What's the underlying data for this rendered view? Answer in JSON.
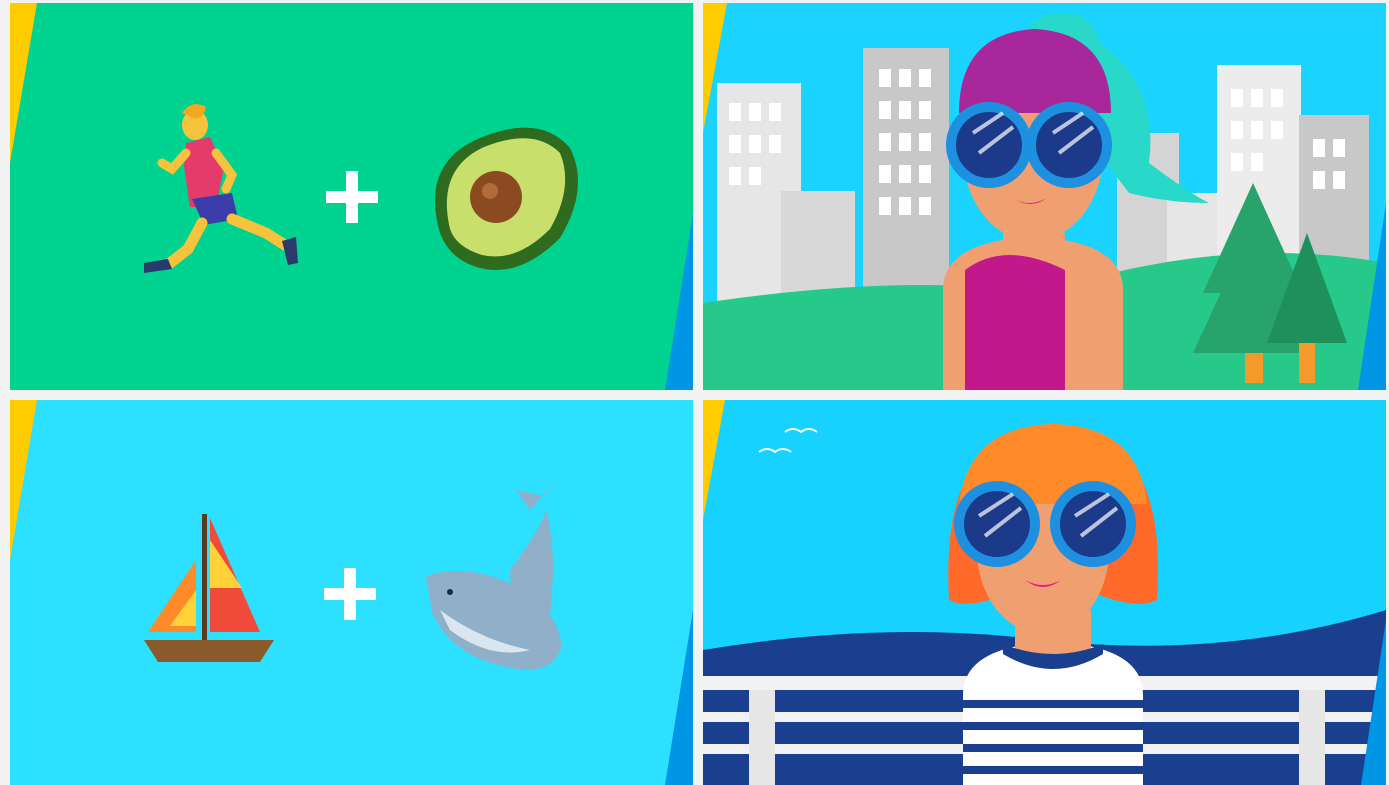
{
  "panels": [
    {
      "id": "p1",
      "name": "emoji-runner-plus-avocado",
      "bg": "#00d28f",
      "emoji_left": "man-running-icon",
      "operator": "+",
      "emoji_right": "avocado-icon"
    },
    {
      "id": "p2",
      "name": "city-park-scene",
      "bg": "#1ad4ff",
      "character": "woman-with-headwrap-and-sunglasses"
    },
    {
      "id": "p3",
      "name": "emoji-sailboat-plus-whale",
      "bg": "#2ee0ff",
      "emoji_left": "sailboat-icon",
      "operator": "+",
      "emoji_right": "whale-icon"
    },
    {
      "id": "p4",
      "name": "seaside-scene",
      "bg": "#17d2ff",
      "character": "woman-with-orange-bob-and-sunglasses"
    }
  ],
  "colors": {
    "stripe_yellow": "#ffcc00",
    "stripe_blue": "#0096e6",
    "green_bg": "#00d28f",
    "cyan_bg": "#2ee0ff",
    "sky": "#1ad4ff"
  }
}
